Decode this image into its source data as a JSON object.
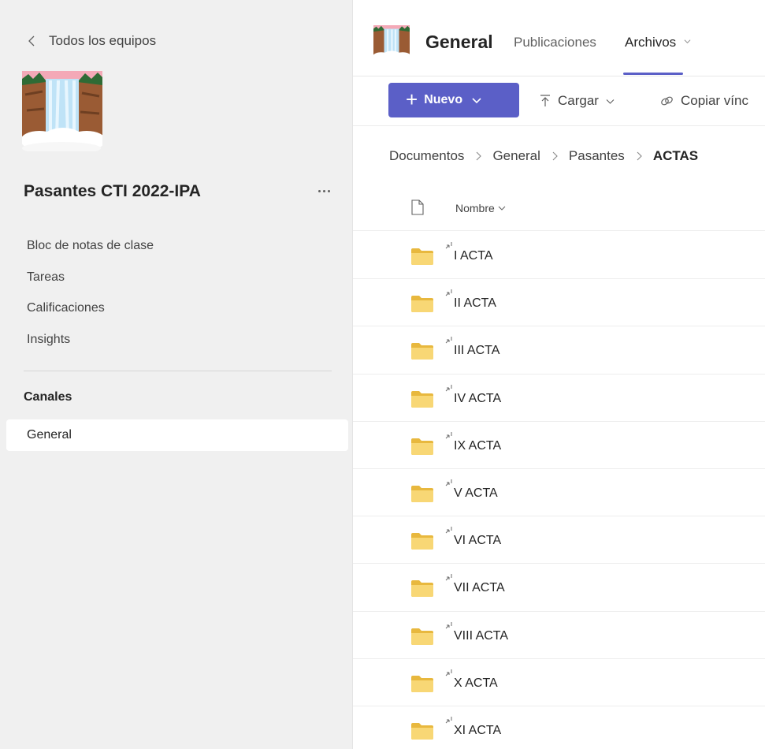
{
  "sidebar": {
    "back_label": "Todos los equipos",
    "team_name": "Pasantes CTI 2022-IPA",
    "nav_items": [
      {
        "label": "Bloc de notas de clase"
      },
      {
        "label": "Tareas"
      },
      {
        "label": "Calificaciones"
      },
      {
        "label": "Insights"
      }
    ],
    "channels_title": "Canales",
    "channels": [
      {
        "label": "General",
        "selected": true
      }
    ]
  },
  "header": {
    "channel_name": "General",
    "tabs": [
      {
        "label": "Publicaciones",
        "active": false
      },
      {
        "label": "Archivos",
        "active": true
      }
    ]
  },
  "toolbar": {
    "new_label": "Nuevo",
    "upload_label": "Cargar",
    "copy_link_label": "Copiar vínc"
  },
  "breadcrumb": [
    "Documentos",
    "General",
    "Pasantes",
    "ACTAS"
  ],
  "list": {
    "name_column": "Nombre",
    "items": [
      {
        "name": "I ACTA"
      },
      {
        "name": "II ACTA"
      },
      {
        "name": "III ACTA"
      },
      {
        "name": "IV ACTA"
      },
      {
        "name": "IX ACTA"
      },
      {
        "name": "V ACTA"
      },
      {
        "name": "VI ACTA"
      },
      {
        "name": "VII ACTA"
      },
      {
        "name": "VIII ACTA"
      },
      {
        "name": "X ACTA"
      },
      {
        "name": "XI ACTA"
      }
    ]
  },
  "colors": {
    "accent": "#5b5fc7",
    "folder": "#f8d775",
    "sidebar_bg": "#f0f0f0"
  },
  "icons": {
    "back": "chevron-left-icon",
    "more": "more-horizontal-icon",
    "upload": "upload-arrow-icon",
    "link": "link-icon",
    "file_type": "document-icon",
    "folder": "folder-icon",
    "sync": "sync-indicator-icon"
  }
}
